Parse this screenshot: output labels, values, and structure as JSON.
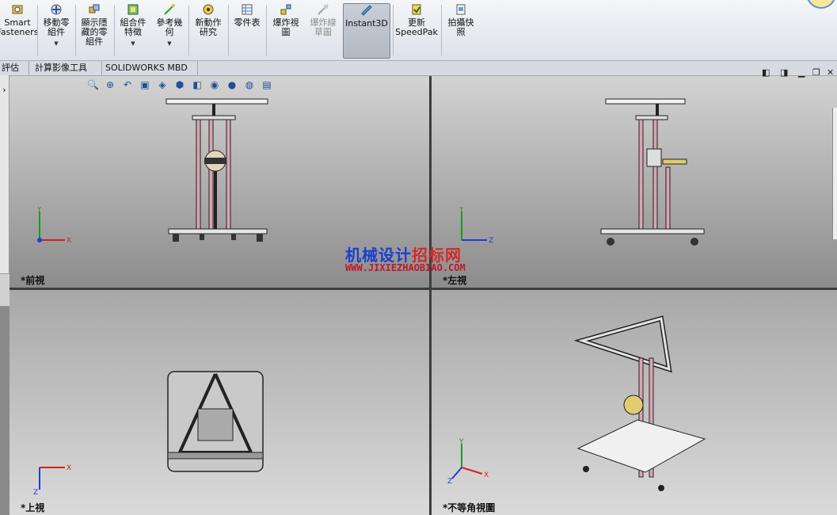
{
  "ribbon": {
    "buttons": [
      {
        "label": "Smart\nFasteners",
        "icon": "smart-fasteners-icon"
      },
      {
        "label": "移動零\n組件",
        "icon": "move-component-icon"
      },
      {
        "label": "顯示隱\n藏的零\n組件",
        "icon": "show-hidden-icon"
      },
      {
        "label": "組合件\n特徵",
        "icon": "assembly-feature-icon"
      },
      {
        "label": "參考幾\n何",
        "icon": "reference-geometry-icon"
      },
      {
        "label": "新動作\n研究",
        "icon": "motion-study-icon"
      },
      {
        "label": "零件表",
        "icon": "bom-icon"
      },
      {
        "label": "爆炸視\n圖",
        "icon": "exploded-view-icon"
      },
      {
        "label": "爆炸線\n草圖",
        "icon": "explode-line-icon"
      },
      {
        "label": "Instant3D",
        "icon": "instant3d-icon"
      },
      {
        "label": "更新\nSpeedPak",
        "icon": "speedpak-icon"
      },
      {
        "label": "拍攝快\n照",
        "icon": "snapshot-icon"
      }
    ]
  },
  "tabs": [
    "評估",
    "計算影像工具",
    "SOLIDWORKS MBD"
  ],
  "viewports": {
    "front": "*前視",
    "left": "*左視",
    "top": "*上視",
    "iso": "*不等角視圖"
  },
  "axes": {
    "x": "X",
    "y": "Y",
    "z": "Z"
  },
  "watermark": {
    "title_blue": "机械设计",
    "title_red": "招标网",
    "url": "WWW.JIXIEZHAOBIAO.COM"
  },
  "colors": {
    "axis_x": "#d62020",
    "axis_y": "#1c9a1c",
    "axis_z": "#1c3fd8",
    "rod": "#d9a5b3",
    "frame": "#1a1a1a"
  }
}
